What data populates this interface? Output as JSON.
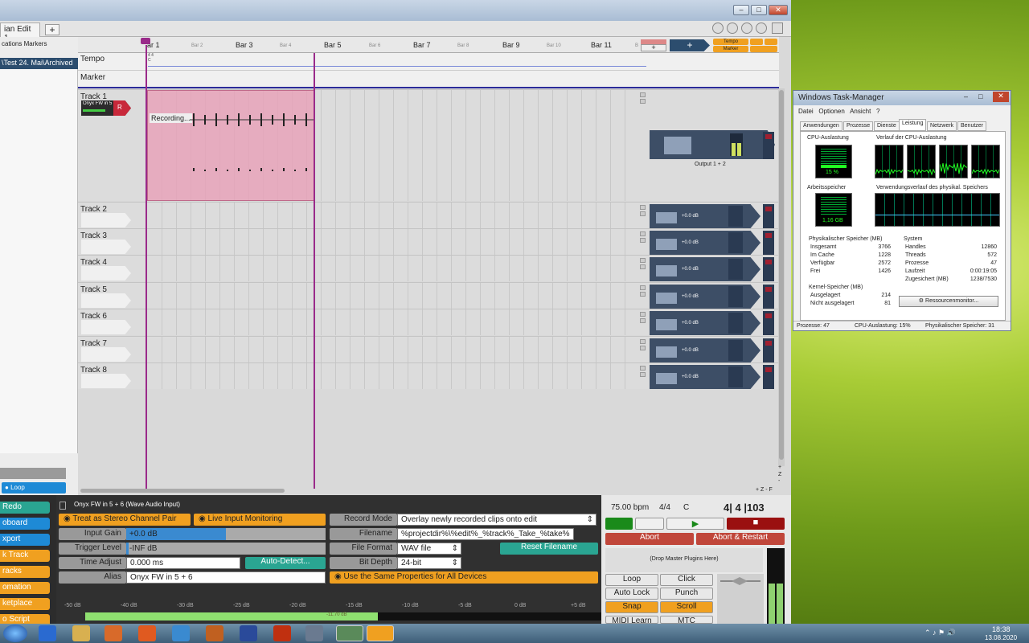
{
  "editor": {
    "edit_tab": "ian Edit 1",
    "add_tab": "+",
    "left_tabs": "cations Markers",
    "path": "\\Test 24. Mai\\Archived",
    "loop_label": "Loop",
    "bars": [
      "ar 1",
      "Bar 3",
      "Bar 5",
      "Bar 7",
      "Bar 9",
      "Bar 11"
    ],
    "minor_bars": [
      "Bar 2",
      "Bar 4",
      "Bar 6",
      "Bar 8",
      "Bar 10",
      "B"
    ],
    "tempo_label": "Tempo",
    "tempo_sig": "4 4 C",
    "marker_label": "Marker",
    "tempo_btn": "Tempo",
    "marker_btn": "Marker",
    "track1_name": "Track 1",
    "track1_device": "Onyx FW in 5 +",
    "track1_rec": "R",
    "recording_text": "Recording...",
    "output_label": "Output 1 + 2",
    "tracks": [
      "Track 2",
      "Track 3",
      "Track 4",
      "Track 5",
      "Track 6",
      "Track 7",
      "Track 8"
    ],
    "db_label": "+0.0 dB",
    "zoom_plus": "+",
    "zoom_z": "Z",
    "zoom_minus": "-",
    "zoom_row": "+ Z - F"
  },
  "left_buttons": [
    "Redo",
    "oboard",
    "xport",
    "k Track",
    "racks",
    "omation",
    "ketplace",
    "o Script"
  ],
  "props": {
    "header": "Onyx FW in 5 + 6 (Wave Audio Input)",
    "stereo": "Treat as Stereo Channel Pair",
    "monitor": "Live Input Monitoring",
    "input_gain_label": "Input Gain",
    "input_gain": "+0.0 dB",
    "trigger_label": "Trigger Level",
    "trigger": "-INF dB",
    "time_adjust_label": "Time Adjust",
    "time_adjust": "0.000 ms",
    "auto_detect": "Auto-Detect...",
    "alias_label": "Alias",
    "alias": "Onyx FW in 5 + 6",
    "record_mode_label": "Record Mode",
    "record_mode": "Overlay newly recorded clips onto edit",
    "filename_label": "Filename",
    "filename": "%projectdir%\\%edit%_%track%_Take_%take%",
    "file_format_label": "File Format",
    "file_format": "WAV file",
    "reset_filename": "Reset Filename",
    "bit_depth_label": "Bit Depth",
    "bit_depth": "24-bit",
    "same_props": "Use the Same Properties for All Devices",
    "meter_ticks": [
      "-50 dB",
      "-40 dB",
      "-30 dB",
      "-25 dB",
      "-20 dB",
      "-15 dB",
      "-10 dB",
      "-5 dB",
      "0 dB",
      "+5 dB"
    ],
    "meter_value": "-11.70 dB"
  },
  "transport": {
    "bpm": "75.00 bpm",
    "sig": "4/4",
    "key": "C",
    "position": "4| 4 |103",
    "abort": "Abort",
    "abort_restart": "Abort & Restart",
    "drop_plugins": "(Drop Master Plugins Here)",
    "loop": "Loop",
    "click": "Click",
    "auto_lock": "Auto Lock",
    "punch": "Punch",
    "snap": "Snap",
    "scroll": "Scroll",
    "midi_learn": "MIDI Learn",
    "mtc": "MTC"
  },
  "taskmgr": {
    "title": "Windows Task-Manager",
    "menu": [
      "Datei",
      "Optionen",
      "Ansicht",
      "?"
    ],
    "tabs": [
      "Anwendungen",
      "Prozesse",
      "Dienste",
      "Leistung",
      "Netzwerk",
      "Benutzer"
    ],
    "cpu_label": "CPU-Auslastung",
    "cpu_value": "15 %",
    "cpu_hist": "Verlauf der CPU-Auslastung",
    "mem_label": "Arbeitsspeicher",
    "mem_value": "1,16 GB",
    "mem_hist": "Verwendungsverlauf des physikal. Speichers",
    "phys_title": "Physikalischer Speicher (MB)",
    "phys": [
      [
        "Insgesamt",
        "3766"
      ],
      [
        "Im Cache",
        "1228"
      ],
      [
        "Verfügbar",
        "2572"
      ],
      [
        "Frei",
        "1426"
      ]
    ],
    "sys_title": "System",
    "sys": [
      [
        "Handles",
        "12860"
      ],
      [
        "Threads",
        "572"
      ],
      [
        "Prozesse",
        "47"
      ],
      [
        "Laufzeit",
        "0:00:19:05"
      ],
      [
        "Zugesichert (MB)",
        "1238/7530"
      ]
    ],
    "kernel_title": "Kernel-Speicher (MB)",
    "kernel": [
      [
        "Ausgelagert",
        "214"
      ],
      [
        "Nicht ausgelagert",
        "81"
      ]
    ],
    "resmon": "Ressourcenmonitor...",
    "status": [
      "Prozesse: 47",
      "CPU-Auslastung: 15%",
      "Physikalischer Speicher: 31"
    ]
  },
  "taskbar": {
    "time": "18:38",
    "date": "13.08.2020"
  }
}
